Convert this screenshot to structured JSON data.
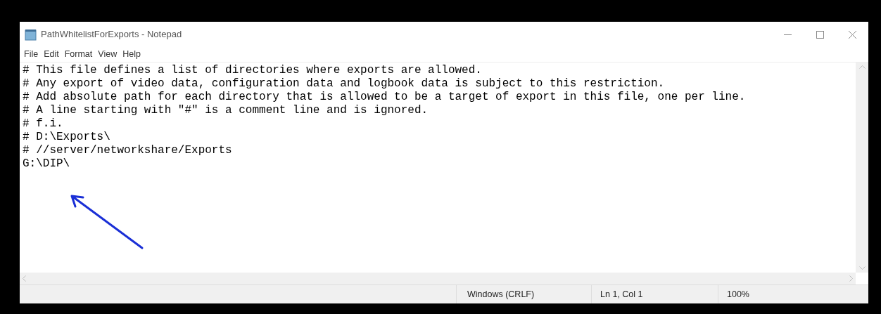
{
  "window": {
    "title": "PathWhitelistForExports - Notepad"
  },
  "menu": [
    "File",
    "Edit",
    "Format",
    "View",
    "Help"
  ],
  "lines": [
    "# This file defines a list of directories where exports are allowed.",
    "# Any export of video data, configuration data and logbook data is subject to this restriction.",
    "# Add absolute path for each directory that is allowed to be a target of export in this file, one per line.",
    "# A line starting with \"#\" is a comment line and is ignored.",
    "# f.i.",
    "# D:\\Exports\\",
    "# //server/networkshare/Exports",
    "G:\\DIP\\"
  ],
  "status_bar": {
    "line_ending": "Windows (CRLF)",
    "position": "Ln 1, Col 1",
    "zoom": "100%"
  }
}
